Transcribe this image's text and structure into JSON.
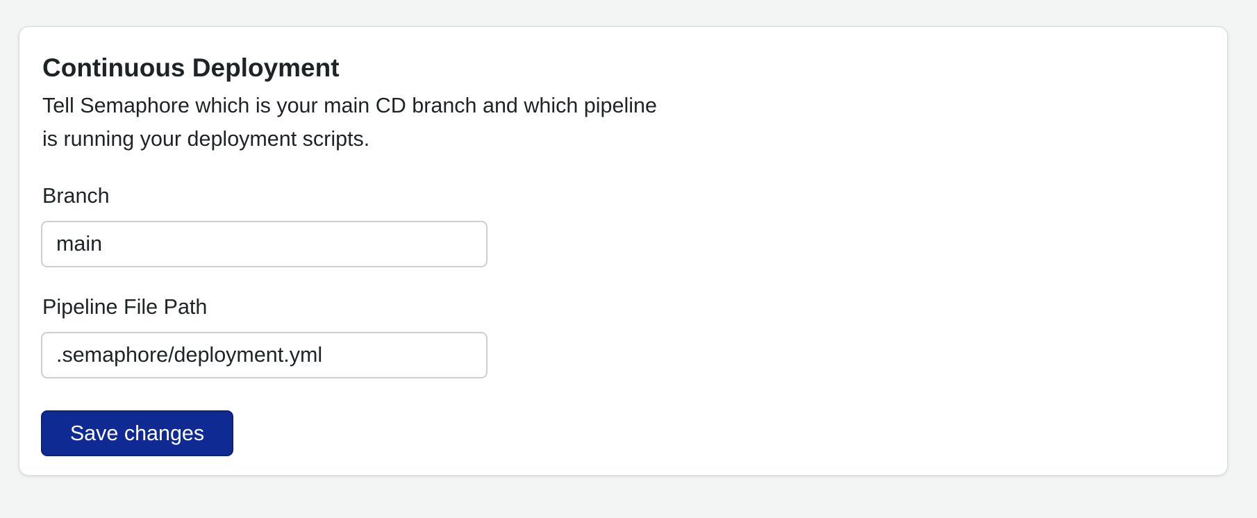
{
  "section": {
    "title": "Continuous Deployment",
    "description": "Tell Semaphore which is your main CD branch and which pipeline is running your deployment scripts."
  },
  "branch": {
    "label": "Branch",
    "value": "main"
  },
  "pipeline_path": {
    "label": "Pipeline File Path",
    "value": ".semaphore/deployment.yml"
  },
  "actions": {
    "save_label": "Save changes"
  },
  "colors": {
    "page_background": "#f3f5f5",
    "card_background": "#ffffff",
    "primary_button": "#0f2a93",
    "text": "#1e2326",
    "input_border": "#cbcfd1"
  }
}
